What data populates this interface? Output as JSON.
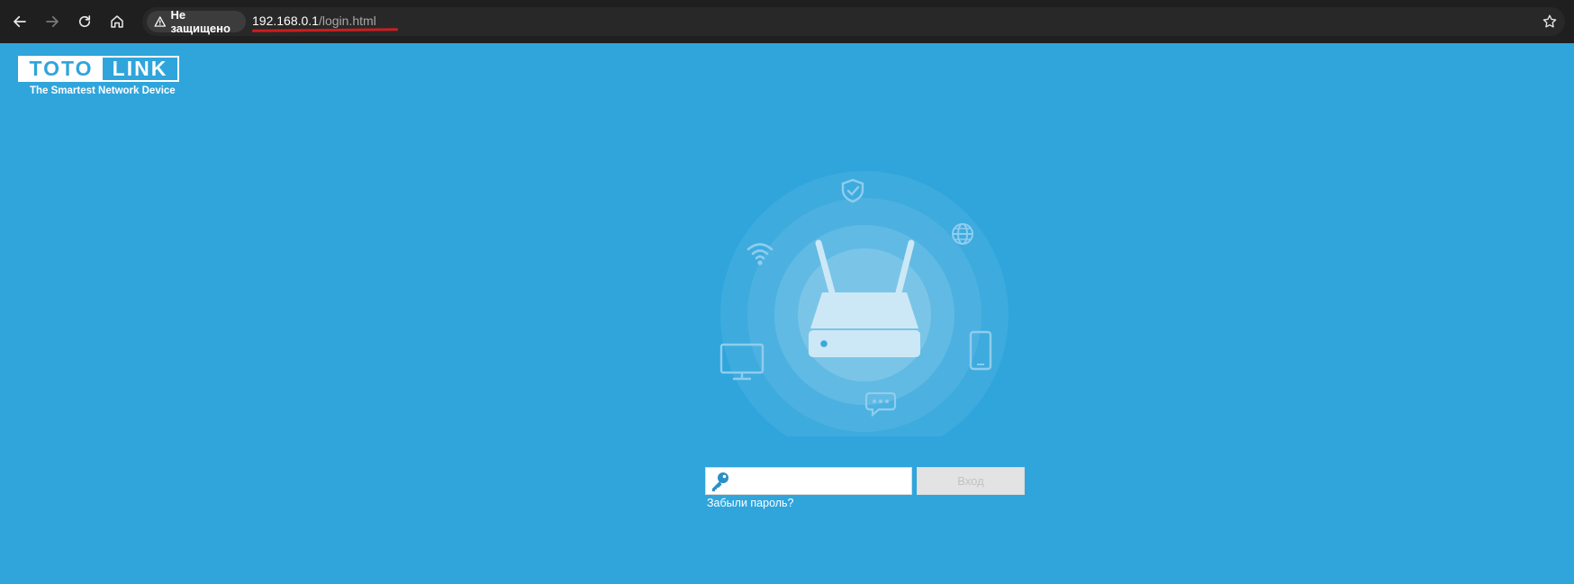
{
  "browser": {
    "security_label": "Не защищено",
    "url_host": "192.168.0.1",
    "url_path": "/login.html"
  },
  "brand": {
    "logo_part1": "TOTO",
    "logo_part2": "LINK",
    "tagline": "The Smartest Network Device"
  },
  "login": {
    "password_value": "",
    "submit_label": "Вход",
    "forgot_label": "Забыли пароль?"
  },
  "icons": {
    "back": "back-arrow-icon",
    "forward": "forward-arrow-icon",
    "reload": "reload-icon",
    "home": "home-icon",
    "warning": "warning-icon",
    "bookmark": "star-icon",
    "key": "key-icon",
    "router": "router-icon",
    "shield": "shield-check-icon",
    "globe": "globe-icon",
    "wifi": "wifi-icon",
    "monitor": "monitor-icon",
    "phone": "smartphone-icon",
    "chat": "chat-bubble-icon"
  },
  "colors": {
    "page_background": "#2fa5dc",
    "chrome_background": "#1f1f1f",
    "url_highlight": "#cc1e1e",
    "button_disabled_bg": "#e3e3e3"
  }
}
